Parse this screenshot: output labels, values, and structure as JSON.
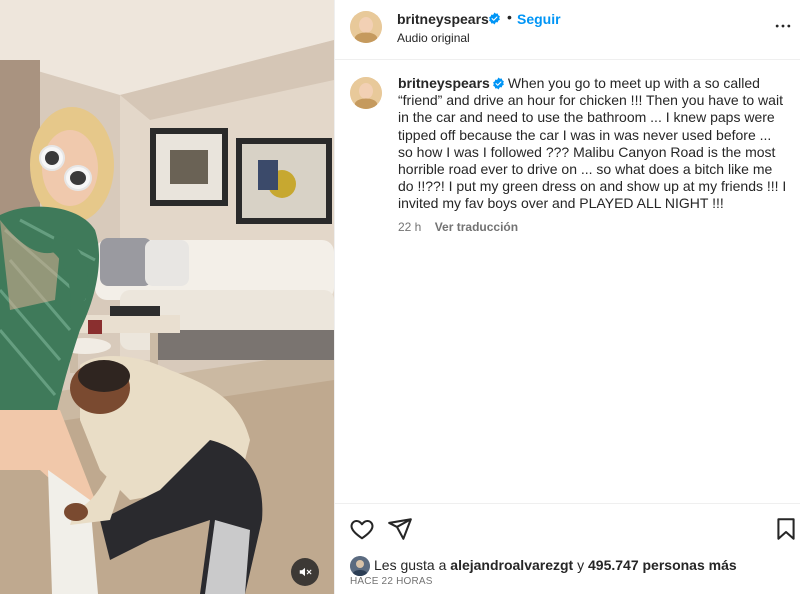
{
  "post": {
    "username": "britneyspears",
    "verified": true,
    "separator": "•",
    "follow_label": "Seguir",
    "audio_label": "Audio original"
  },
  "caption": {
    "username": "britneyspears",
    "text": "When you go to meet up with a so called “friend” and drive an hour for chicken !!! Then you have to wait in the car and need to use the bathroom ... I knew paps were tipped off because the car I was in was never used before ... so how I was I followed ??? Malibu Canyon Road is the most horrible road ever to drive on ... so what does a bitch like me do !!??! I put my green dress on and show up at my friends !!! I invited my fav boys over and PLAYED ALL NIGHT !!!",
    "time": "22 h",
    "translate_label": "Ver traducción"
  },
  "likes": {
    "prefix": "Les gusta a",
    "user": "alejandroalvarezgt",
    "connector": "y",
    "count_text": "495.747 personas más"
  },
  "posted_ago": "HACE 22 HORAS",
  "icons": {
    "more": "more-options-icon",
    "like": "heart-icon",
    "share": "paper-plane-icon",
    "save": "bookmark-icon",
    "mute": "speaker-muted-icon",
    "verified": "verified-badge-icon"
  },
  "colors": {
    "accent": "#0095f6",
    "text": "#262626",
    "muted": "#737373",
    "border": "#efefef",
    "dress": "#3f7a5a"
  }
}
